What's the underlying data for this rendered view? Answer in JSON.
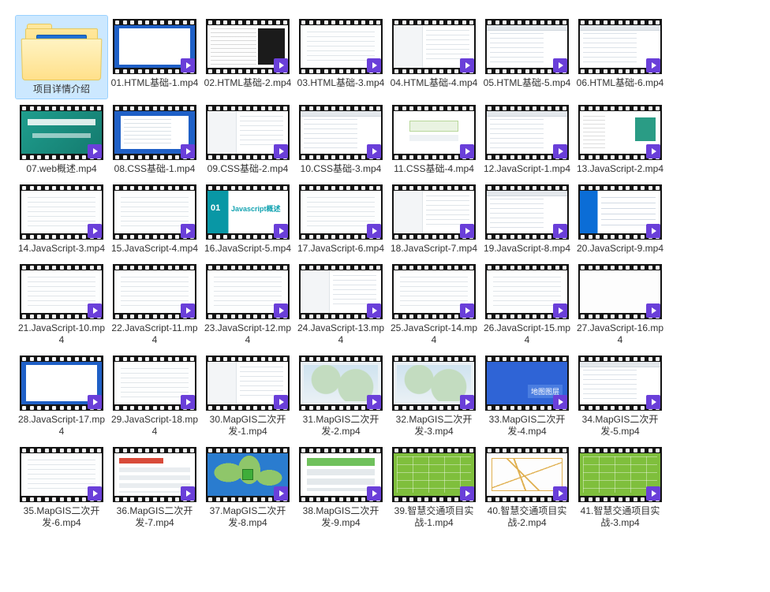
{
  "folder": {
    "name": "项目详情介绍",
    "selected": true
  },
  "items": [
    {
      "name": "01.HTML基础-1.mp4",
      "thumb": "f-bwin"
    },
    {
      "name": "02.HTML基础-2.mp4",
      "thumb": "f-code"
    },
    {
      "name": "03.HTML基础-3.mp4",
      "thumb": "f-blank"
    },
    {
      "name": "04.HTML基础-4.mp4",
      "thumb": "f-split"
    },
    {
      "name": "05.HTML基础-5.mp4",
      "thumb": "f-browser"
    },
    {
      "name": "06.HTML基础-6.mp4",
      "thumb": "f-browser"
    },
    {
      "name": "07.web概述.mp4",
      "thumb": "f-teal"
    },
    {
      "name": "08.CSS基础-1.mp4",
      "thumb": "f-ide"
    },
    {
      "name": "09.CSS基础-2.mp4",
      "thumb": "f-split"
    },
    {
      "name": "10.CSS基础-3.mp4",
      "thumb": "f-browser"
    },
    {
      "name": "11.CSS基础-4.mp4",
      "thumb": "f-form"
    },
    {
      "name": "12.JavaScript-1.mp4",
      "thumb": "f-browser"
    },
    {
      "name": "13.JavaScript-2.mp4",
      "thumb": "f-thumbside"
    },
    {
      "name": "14.JavaScript-3.mp4",
      "thumb": "f-blank"
    },
    {
      "name": "15.JavaScript-4.mp4",
      "thumb": "f-blank"
    },
    {
      "name": "16.JavaScript-5.mp4",
      "thumb": "f-js"
    },
    {
      "name": "17.JavaScript-6.mp4",
      "thumb": "f-blank"
    },
    {
      "name": "18.JavaScript-7.mp4",
      "thumb": "f-split"
    },
    {
      "name": "19.JavaScript-8.mp4",
      "thumb": "f-browser"
    },
    {
      "name": "20.JavaScript-9.mp4",
      "thumb": "f-blue"
    },
    {
      "name": "21.JavaScript-10.mp4",
      "thumb": "f-blank"
    },
    {
      "name": "22.JavaScript-11.mp4",
      "thumb": "f-blank"
    },
    {
      "name": "23.JavaScript-12.mp4",
      "thumb": "f-blank"
    },
    {
      "name": "24.JavaScript-13.mp4",
      "thumb": "f-split"
    },
    {
      "name": "25.JavaScript-14.mp4",
      "thumb": "f-blank"
    },
    {
      "name": "26.JavaScript-15.mp4",
      "thumb": "f-blank"
    },
    {
      "name": "27.JavaScript-16.mp4",
      "thumb": "f-white"
    },
    {
      "name": "28.JavaScript-17.mp4",
      "thumb": "f-bwin"
    },
    {
      "name": "29.JavaScript-18.mp4",
      "thumb": "f-blank"
    },
    {
      "name": "30.MapGIS二次开发-1.mp4",
      "thumb": "f-split"
    },
    {
      "name": "31.MapGIS二次开发-2.mp4",
      "thumb": "f-map"
    },
    {
      "name": "32.MapGIS二次开发-3.mp4",
      "thumb": "f-map"
    },
    {
      "name": "33.MapGIS二次开发-4.mp4",
      "thumb": "f-bluecard"
    },
    {
      "name": "34.MapGIS二次开发-5.mp4",
      "thumb": "f-browser"
    },
    {
      "name": "35.MapGIS二次开发-6.mp4",
      "thumb": "f-blank"
    },
    {
      "name": "36.MapGIS二次开发-7.mp4",
      "thumb": "f-redlist"
    },
    {
      "name": "37.MapGIS二次开发-8.mp4",
      "thumb": "f-worldmap"
    },
    {
      "name": "38.MapGIS二次开发-9.mp4",
      "thumb": "f-greenform"
    },
    {
      "name": "39.智慧交通项目实战-1.mp4",
      "thumb": "f-greensheet"
    },
    {
      "name": "40.智慧交通项目实战-2.mp4",
      "thumb": "f-maplines"
    },
    {
      "name": "41.智慧交通项目实战-3.mp4",
      "thumb": "f-greensheet"
    }
  ]
}
